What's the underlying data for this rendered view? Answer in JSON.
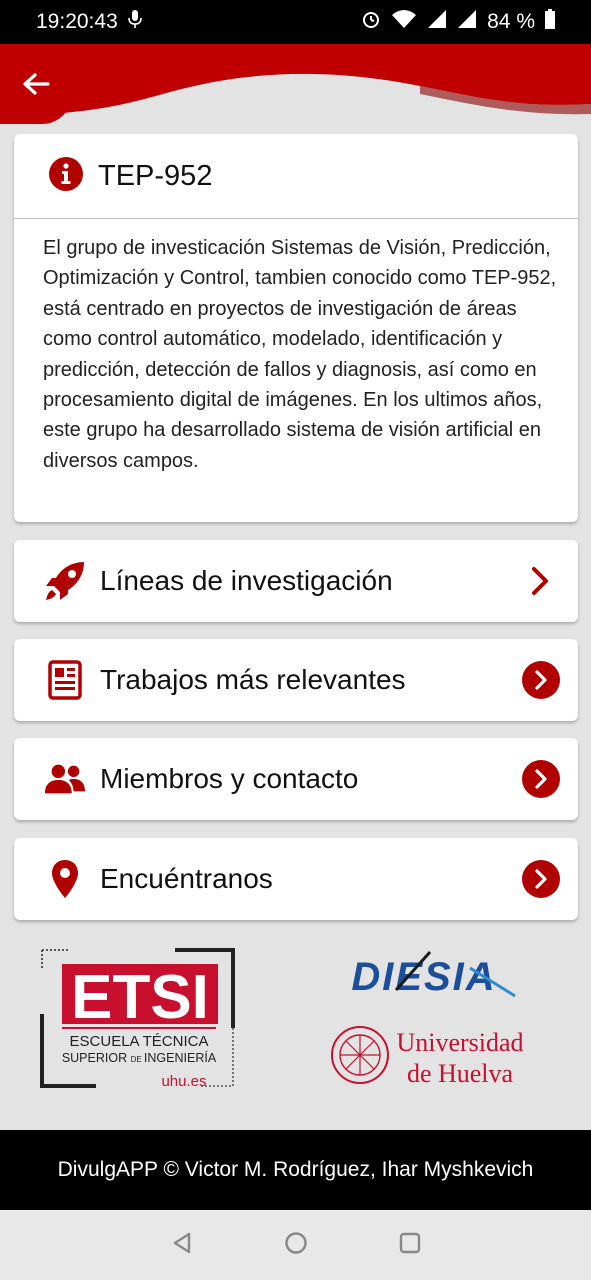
{
  "status_bar": {
    "time": "19:20:43",
    "battery": "84 %"
  },
  "colors": {
    "accent": "#c00000",
    "footer_bg": "#000000"
  },
  "info_card": {
    "title": "TEP-952",
    "description": "El grupo de investicación Sistemas de Visión, Predicción, Optimización y Control, tambien conocido como TEP-952, está centrado en proyectos de investigación de áreas como control automático, modelado, identificación y predicción, detección de fallos y diagnosis, así como en procesamiento digital de imágenes. En los ultimos años, este grupo ha desarrollado sistema de visión artificial en diversos campos."
  },
  "menu": [
    {
      "label": "Líneas de investigación",
      "icon": "rocket-icon"
    },
    {
      "label": "Trabajos más relevantes",
      "icon": "newspaper-icon"
    },
    {
      "label": "Miembros y contacto",
      "icon": "users-icon"
    },
    {
      "label": "Encuéntranos",
      "icon": "map-pin-icon"
    }
  ],
  "logos": {
    "etsi": {
      "big": "ETSI",
      "line1": "ESCUELA TÉCNICA",
      "line2a": "SUPERIOR ",
      "line2b": "DE ",
      "line2c": "INGENIERÍA",
      "domain": "uhu.es"
    },
    "diesia": "DIESIA",
    "uhu": {
      "line1": "Universidad",
      "line2": "de Huelva"
    }
  },
  "footer": {
    "credits": "DivulgAPP © Victor M. Rodríguez, Ihar Myshkevich"
  }
}
